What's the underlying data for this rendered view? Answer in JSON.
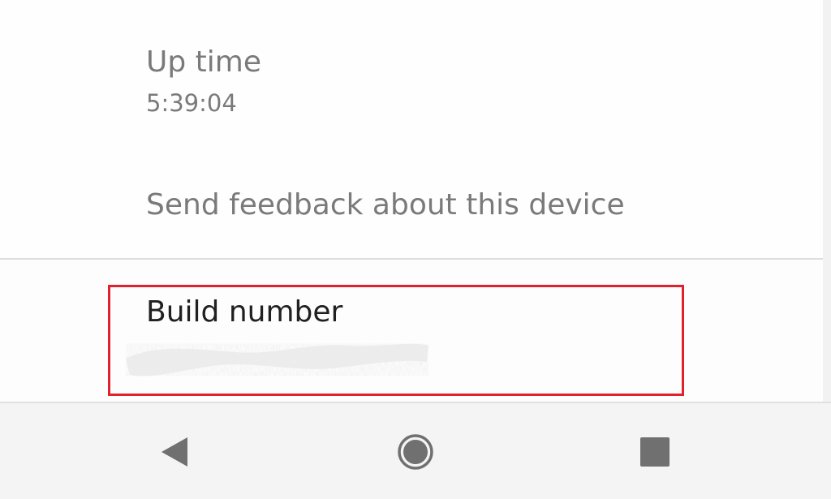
{
  "settings": {
    "uptime": {
      "title": "Up time",
      "value": "5:39:04"
    },
    "feedback": {
      "title": "Send feedback about this device"
    },
    "build": {
      "title": "Build number",
      "value_redacted": true
    }
  },
  "highlight": {
    "color": "#e0222c",
    "target": "build-number-item"
  },
  "navbar": {
    "back_icon": "back-triangle-icon",
    "home_icon": "home-circle-icon",
    "recents_icon": "recents-square-icon",
    "icon_color": "#707070"
  }
}
